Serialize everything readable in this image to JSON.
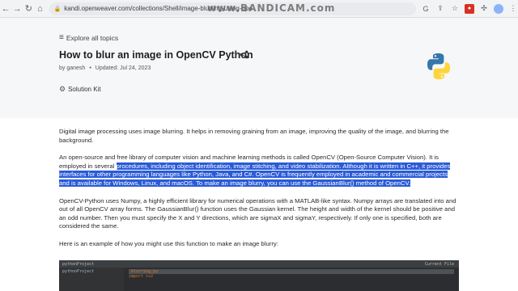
{
  "browser": {
    "url": "kandi.openweaver.com/collections/Shell/image-blurring-using-ope",
    "watermark": "www.BANDICAM.com",
    "icons": [
      "back-icon",
      "forward-icon",
      "reload-icon",
      "home-icon",
      "lock-icon",
      "google-icon",
      "share-icon",
      "star-icon",
      "bandicam-icon",
      "extension-icon",
      "puzzle-icon",
      "avatar-icon",
      "menu-icon"
    ]
  },
  "page": {
    "explore_label": "Explore all topics",
    "title": "How to blur an image in OpenCV Python",
    "author": "by ganesh",
    "dot": "•",
    "updated": "Updated: Jul 24, 2023",
    "solution_kit_label": "Solution Kit"
  },
  "content": {
    "p1": "Digital image processing uses image blurring. It helps in removing graining from an image, improving the quality of the image, and blurring the background.",
    "p2_plain": "An open-source and free library of computer vision and machine learning methods is called OpenCV (Open-Source Computer Vision). It is employed in several ",
    "p2_highlight": "procedures, including object identification, image stitching, and video stabilization. Although it is written in C++, it provides interfaces for other programming languages like Python, Java, and C#. OpenCV is frequently employed in academic and commercial projects and is available for Windows, Linux, and macOS. To make an image blurry, you can use the GaussianBlur() method of OpenCV.",
    "p3": "OpenCV-Python uses Numpy, a highly efficient library for numerical operations with a MATLAB-like syntax. Numpy arrays are translated into and out of all OpenCV array forms. The GaussianBlur() function uses the Gaussian kernel. The height and width of the kernel should be positive and an odd number. Then you must specify the X and Y directions, which are sigmaX and sigmaY, respectively. If only one is specified, both are considered the same.",
    "p4": "Here is an example of how you might use this function to make an image blurry:"
  },
  "code_screenshot": {
    "project_label": "pythonProject",
    "sidebar_item": "pythonProject",
    "tab": "blurring.py",
    "code_line": "import cv2",
    "right_label": "Current File"
  },
  "colors": {
    "highlight": "#2a5bd7",
    "header_bg": "#f6f7f9",
    "python_blue": "#3776ab",
    "python_yellow": "#ffd43b"
  }
}
